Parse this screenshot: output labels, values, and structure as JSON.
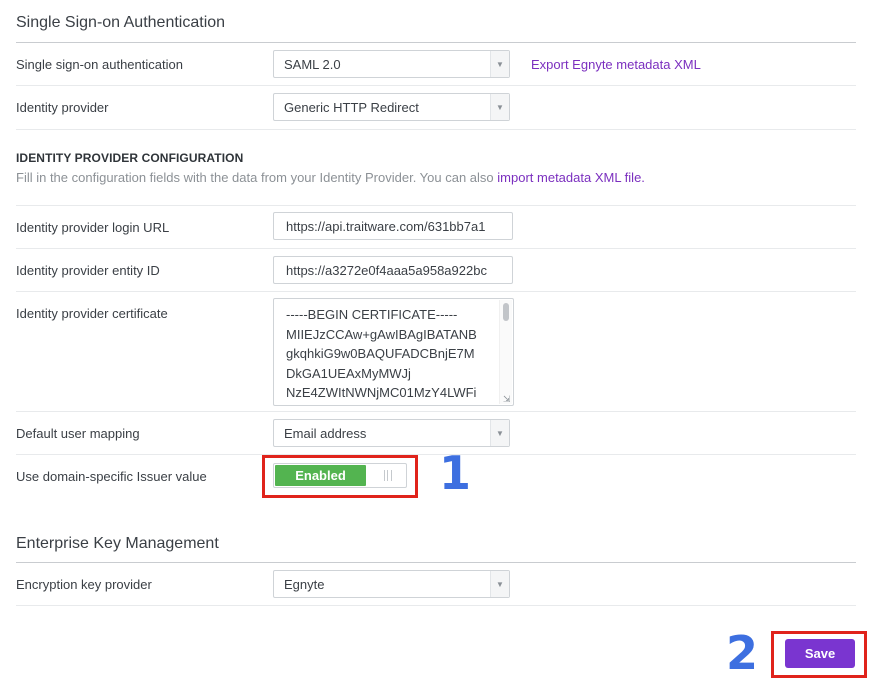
{
  "sso_section": {
    "title": "Single Sign-on Authentication",
    "rows": {
      "sso": {
        "label": "Single sign-on authentication",
        "value": "SAML 2.0",
        "link": "Export Egnyte metadata XML"
      },
      "idp": {
        "label": "Identity provider",
        "value": "Generic HTTP Redirect"
      }
    },
    "config": {
      "heading": "IDENTITY PROVIDER CONFIGURATION",
      "help_text": "Fill in the configuration fields with the data from your Identity Provider. You can also",
      "help_link": "import metadata XML file."
    },
    "fields": {
      "login_url": {
        "label": "Identity provider login URL",
        "value": "https://api.traitware.com/631bb7a1"
      },
      "entity_id": {
        "label": "Identity provider entity ID",
        "value": "https://a3272e0f4aaa5a958a922bc"
      },
      "certificate": {
        "label": "Identity provider certificate",
        "lines": [
          "-----BEGIN CERTIFICATE-----",
          "MIIEJzCCAw+gAwIBAgIBATANB",
          "gkqhkiG9w0BAQUFADCBnjE7M",
          "DkGA1UEAxMyMWJj",
          "NzE4ZWItNWNjMC01MzY4LWFi"
        ]
      },
      "user_mapping": {
        "label": "Default user mapping",
        "value": "Email address"
      },
      "issuer": {
        "label": "Use domain-specific Issuer value",
        "toggle_label": "Enabled",
        "toggle_state": "on"
      }
    }
  },
  "ekm_section": {
    "title": "Enterprise Key Management",
    "provider": {
      "label": "Encryption key provider",
      "value": "Egnyte"
    }
  },
  "actions": {
    "save_label": "Save"
  },
  "annotations": {
    "one": "1",
    "two": "2"
  },
  "colors": {
    "accent_purple": "#7a35d0",
    "link_purple": "#7b2fbf",
    "enabled_green": "#53b450",
    "annotation_red": "#e0231b",
    "annotation_blue": "#3d6fe0"
  },
  "icons": {
    "select_arrow": "chevron-down-icon",
    "toggle_knob": "grip-icon",
    "resize": "resize-grip-icon"
  }
}
